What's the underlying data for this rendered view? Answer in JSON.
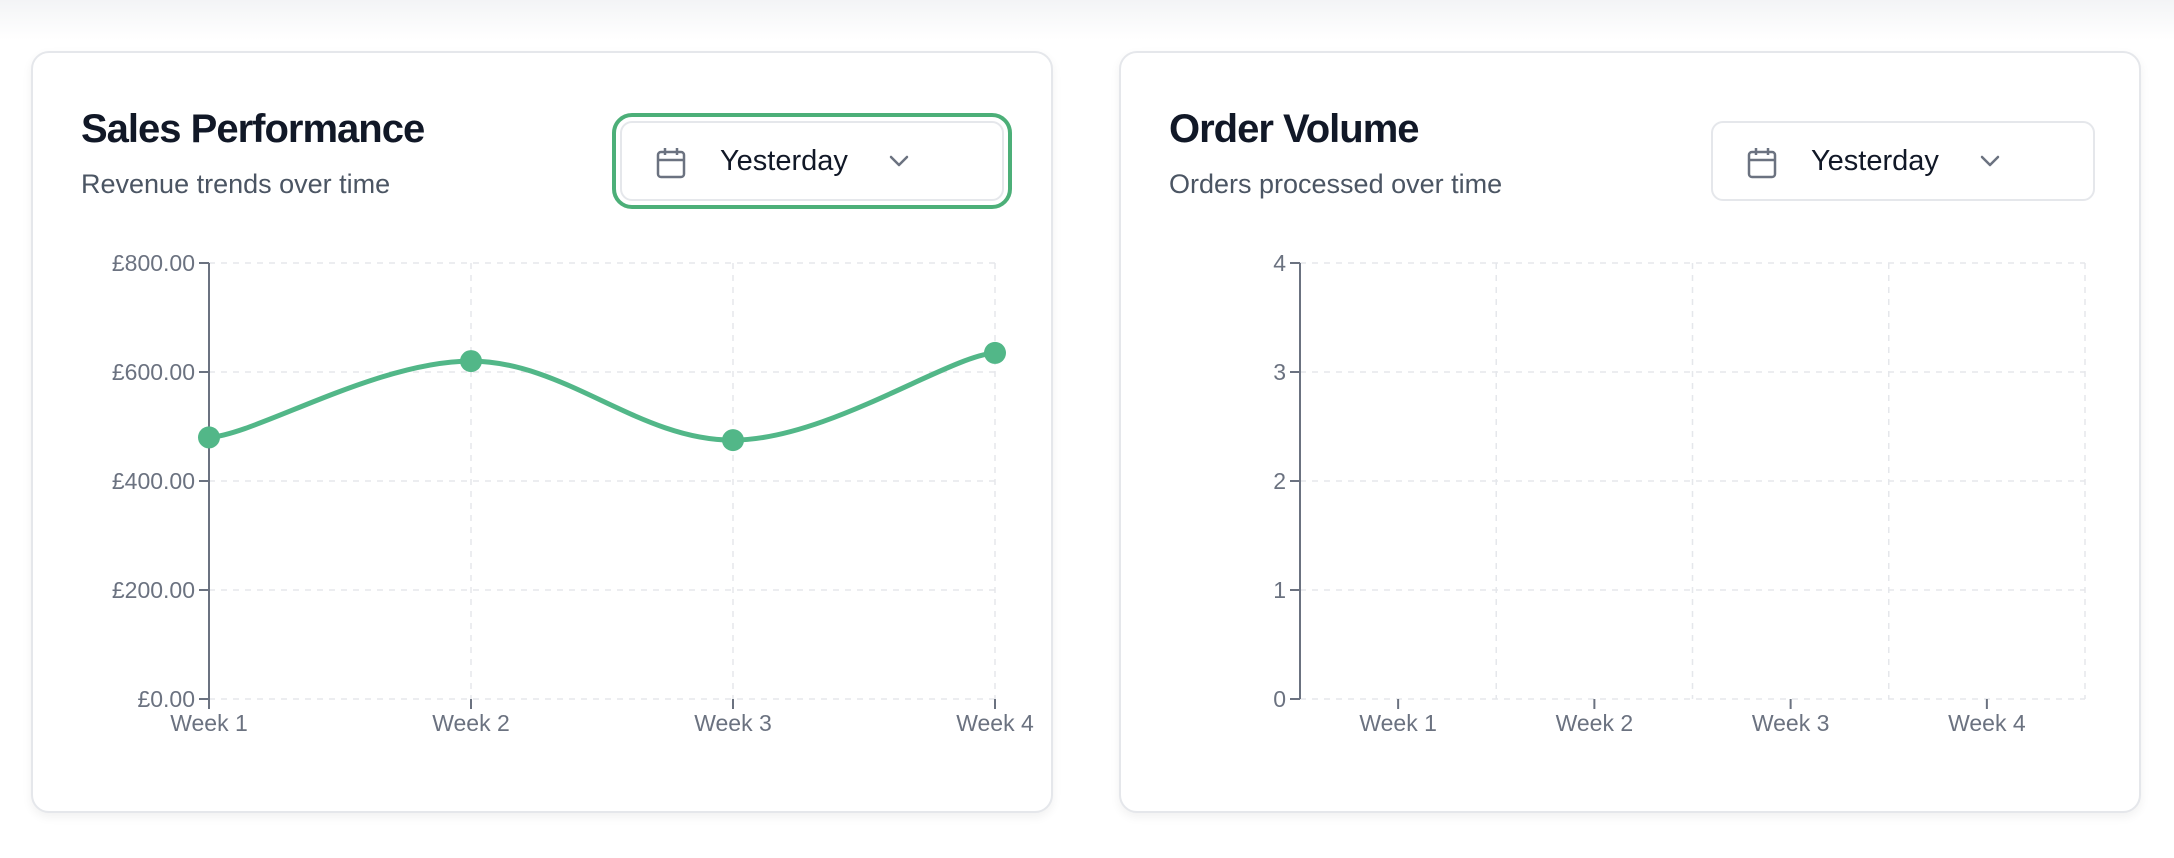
{
  "cards": [
    {
      "title": "Sales Performance",
      "subtitle": "Revenue trends over time",
      "date_filter": {
        "label": "Yesterday",
        "icon": "calendar-icon",
        "chevron": "chevron-down-icon",
        "focused": true
      },
      "chart_data": {
        "type": "line",
        "categories": [
          "Week 1",
          "Week 2",
          "Week 3",
          "Week 4"
        ],
        "series": [
          {
            "values": [
              480,
              620,
              475,
              635
            ],
            "color": "#52b788"
          }
        ],
        "ylim": [
          0,
          800
        ],
        "yticks": [
          "£0.00",
          "£200.00",
          "£400.00",
          "£600.00",
          "£800.00"
        ],
        "grid": true
      }
    },
    {
      "title": "Order Volume",
      "subtitle": "Orders processed over time",
      "date_filter": {
        "label": "Yesterday",
        "icon": "calendar-icon",
        "chevron": "chevron-down-icon",
        "focused": false
      },
      "chart_data": {
        "type": "bar",
        "categories": [
          "Week 1",
          "Week 2",
          "Week 3",
          "Week 4"
        ],
        "series": [],
        "ylim": [
          0,
          4
        ],
        "yticks": [
          "0",
          "1",
          "2",
          "3",
          "4"
        ],
        "grid": true
      }
    }
  ],
  "colors": {
    "accent": "#52b788",
    "focus_ring": "#4caf78",
    "grid": "#e5e7eb",
    "axis_text": "#6b7280"
  }
}
